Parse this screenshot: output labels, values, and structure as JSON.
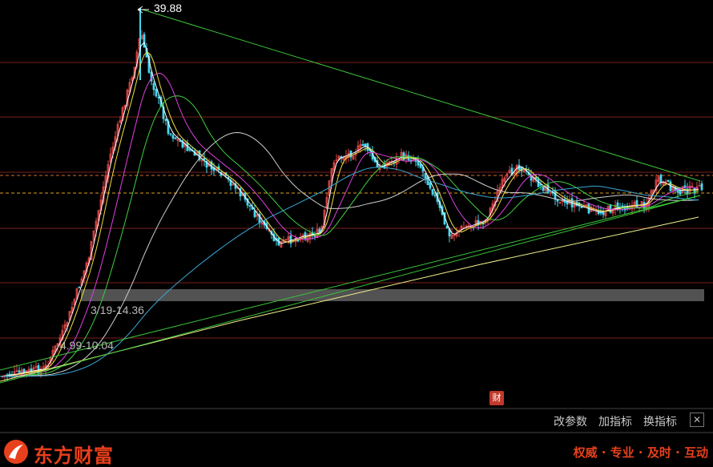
{
  "chart_data": {
    "type": "candlestick",
    "annotations": {
      "high_label": "39.88",
      "band_label_1": "3/19-14.36",
      "band_label_2": "4.99-10.04"
    },
    "price_levels": [
      39.88,
      14.36,
      10.04,
      4.99
    ],
    "peak_price": 39.88
  },
  "badge": {
    "text": "财"
  },
  "toolbar": {
    "modify_params": "改参数",
    "add_indicator": "加指标",
    "switch_indicator": "换指标",
    "close": "✕"
  },
  "footer": {
    "brand": "东方财富",
    "slogan": "权威 · 专业 · 及时 · 互动"
  },
  "colors": {
    "up": "#e04848",
    "down": "#46d7ee",
    "ma5": "#ffffff",
    "ma10": "#f0e040",
    "ma20": "#e040e0",
    "ma30": "#40d040",
    "ma60": "#cfcfcf",
    "ma120": "#3aa8d8",
    "ma250": "#f2f28a",
    "trendline": "#3ac43a",
    "brand": "#e8401c"
  }
}
